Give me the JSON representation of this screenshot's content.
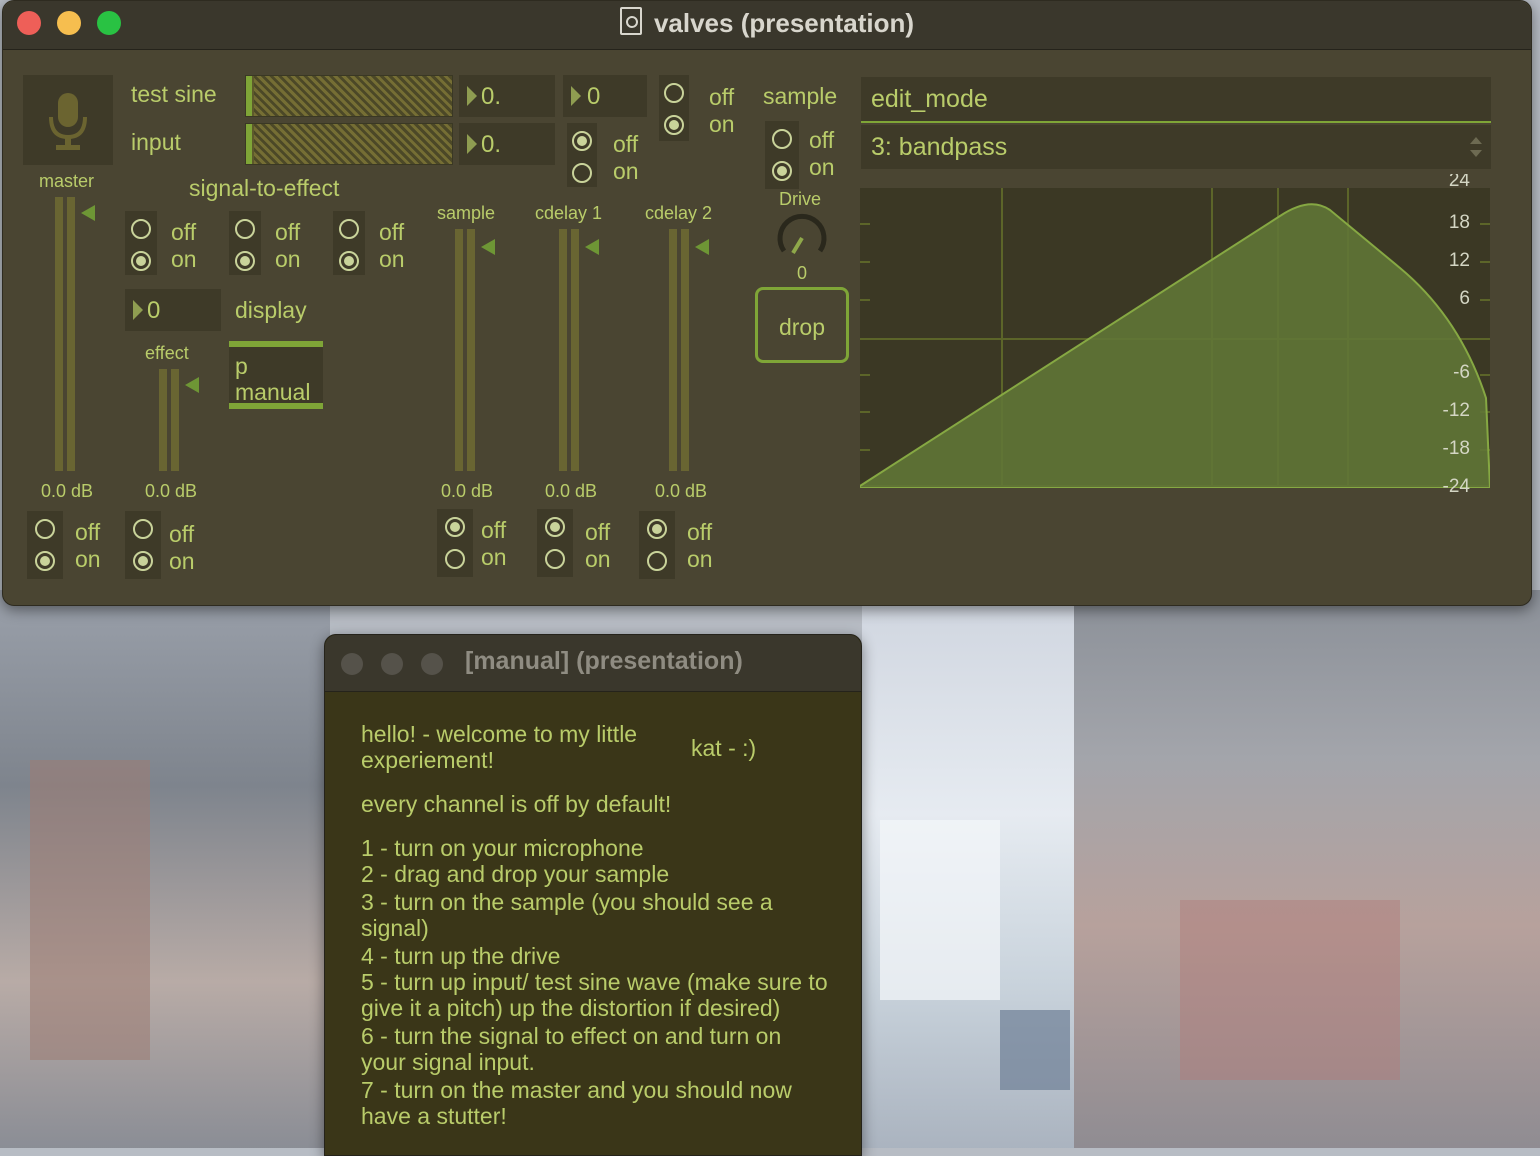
{
  "window": {
    "title": "valves (presentation)",
    "traffic_lights": {
      "close": "#ee5f58",
      "minimize": "#f6be4f",
      "zoom": "#29c243"
    }
  },
  "colors": {
    "panel": "#4a4532",
    "accent": "#b9cc6a",
    "graph_fill": "#6a7f35"
  },
  "left": {
    "mic_icon": "microphone-icon",
    "master_label": "master",
    "master_db": "0.0 dB",
    "test_sine_label": "test sine",
    "input_label": "input",
    "test_sine_value": "0.",
    "input_value": "0.",
    "int_value": "0",
    "signal_to_effect_label": "signal-to-effect",
    "display_value": "0",
    "display_label": "display",
    "effect_label": "effect",
    "effect_db": "0.0 dB",
    "p_manual": "p manual"
  },
  "channels": {
    "sample": {
      "label": "sample",
      "db": "0.0 dB"
    },
    "cdelay1": {
      "label": "cdelay 1",
      "db": "0.0 dB"
    },
    "cdelay2": {
      "label": "cdelay 2",
      "db": "0.0 dB"
    }
  },
  "toggle": {
    "off": "off",
    "on": "on"
  },
  "right": {
    "sample_label": "sample",
    "drive_label": "Drive",
    "drive_value": "0",
    "drop_label": "drop",
    "edit_mode": "edit_mode",
    "filter_selected": "3: bandpass",
    "y_ticks": [
      "24",
      "18",
      "12",
      "6",
      "-6",
      "-12",
      "-18",
      "-24"
    ]
  },
  "manual": {
    "title": "[manual] (presentation)",
    "welcome": "hello! - welcome to my little experiement!",
    "signature": "kat - :)",
    "default_note": "every channel is off by default!",
    "steps": [
      "1 - turn on your microphone",
      "2 - drag and drop your sample",
      "3 - turn on the sample (you should see a signal)",
      "4 - turn up the drive",
      "5 - turn up input/ test sine wave (make sure to give it a pitch) up the distortion if desired)",
      "6 - turn the signal to effect on and turn on your signal input.",
      "7 - turn on the master and you should now have a stutter!"
    ]
  }
}
